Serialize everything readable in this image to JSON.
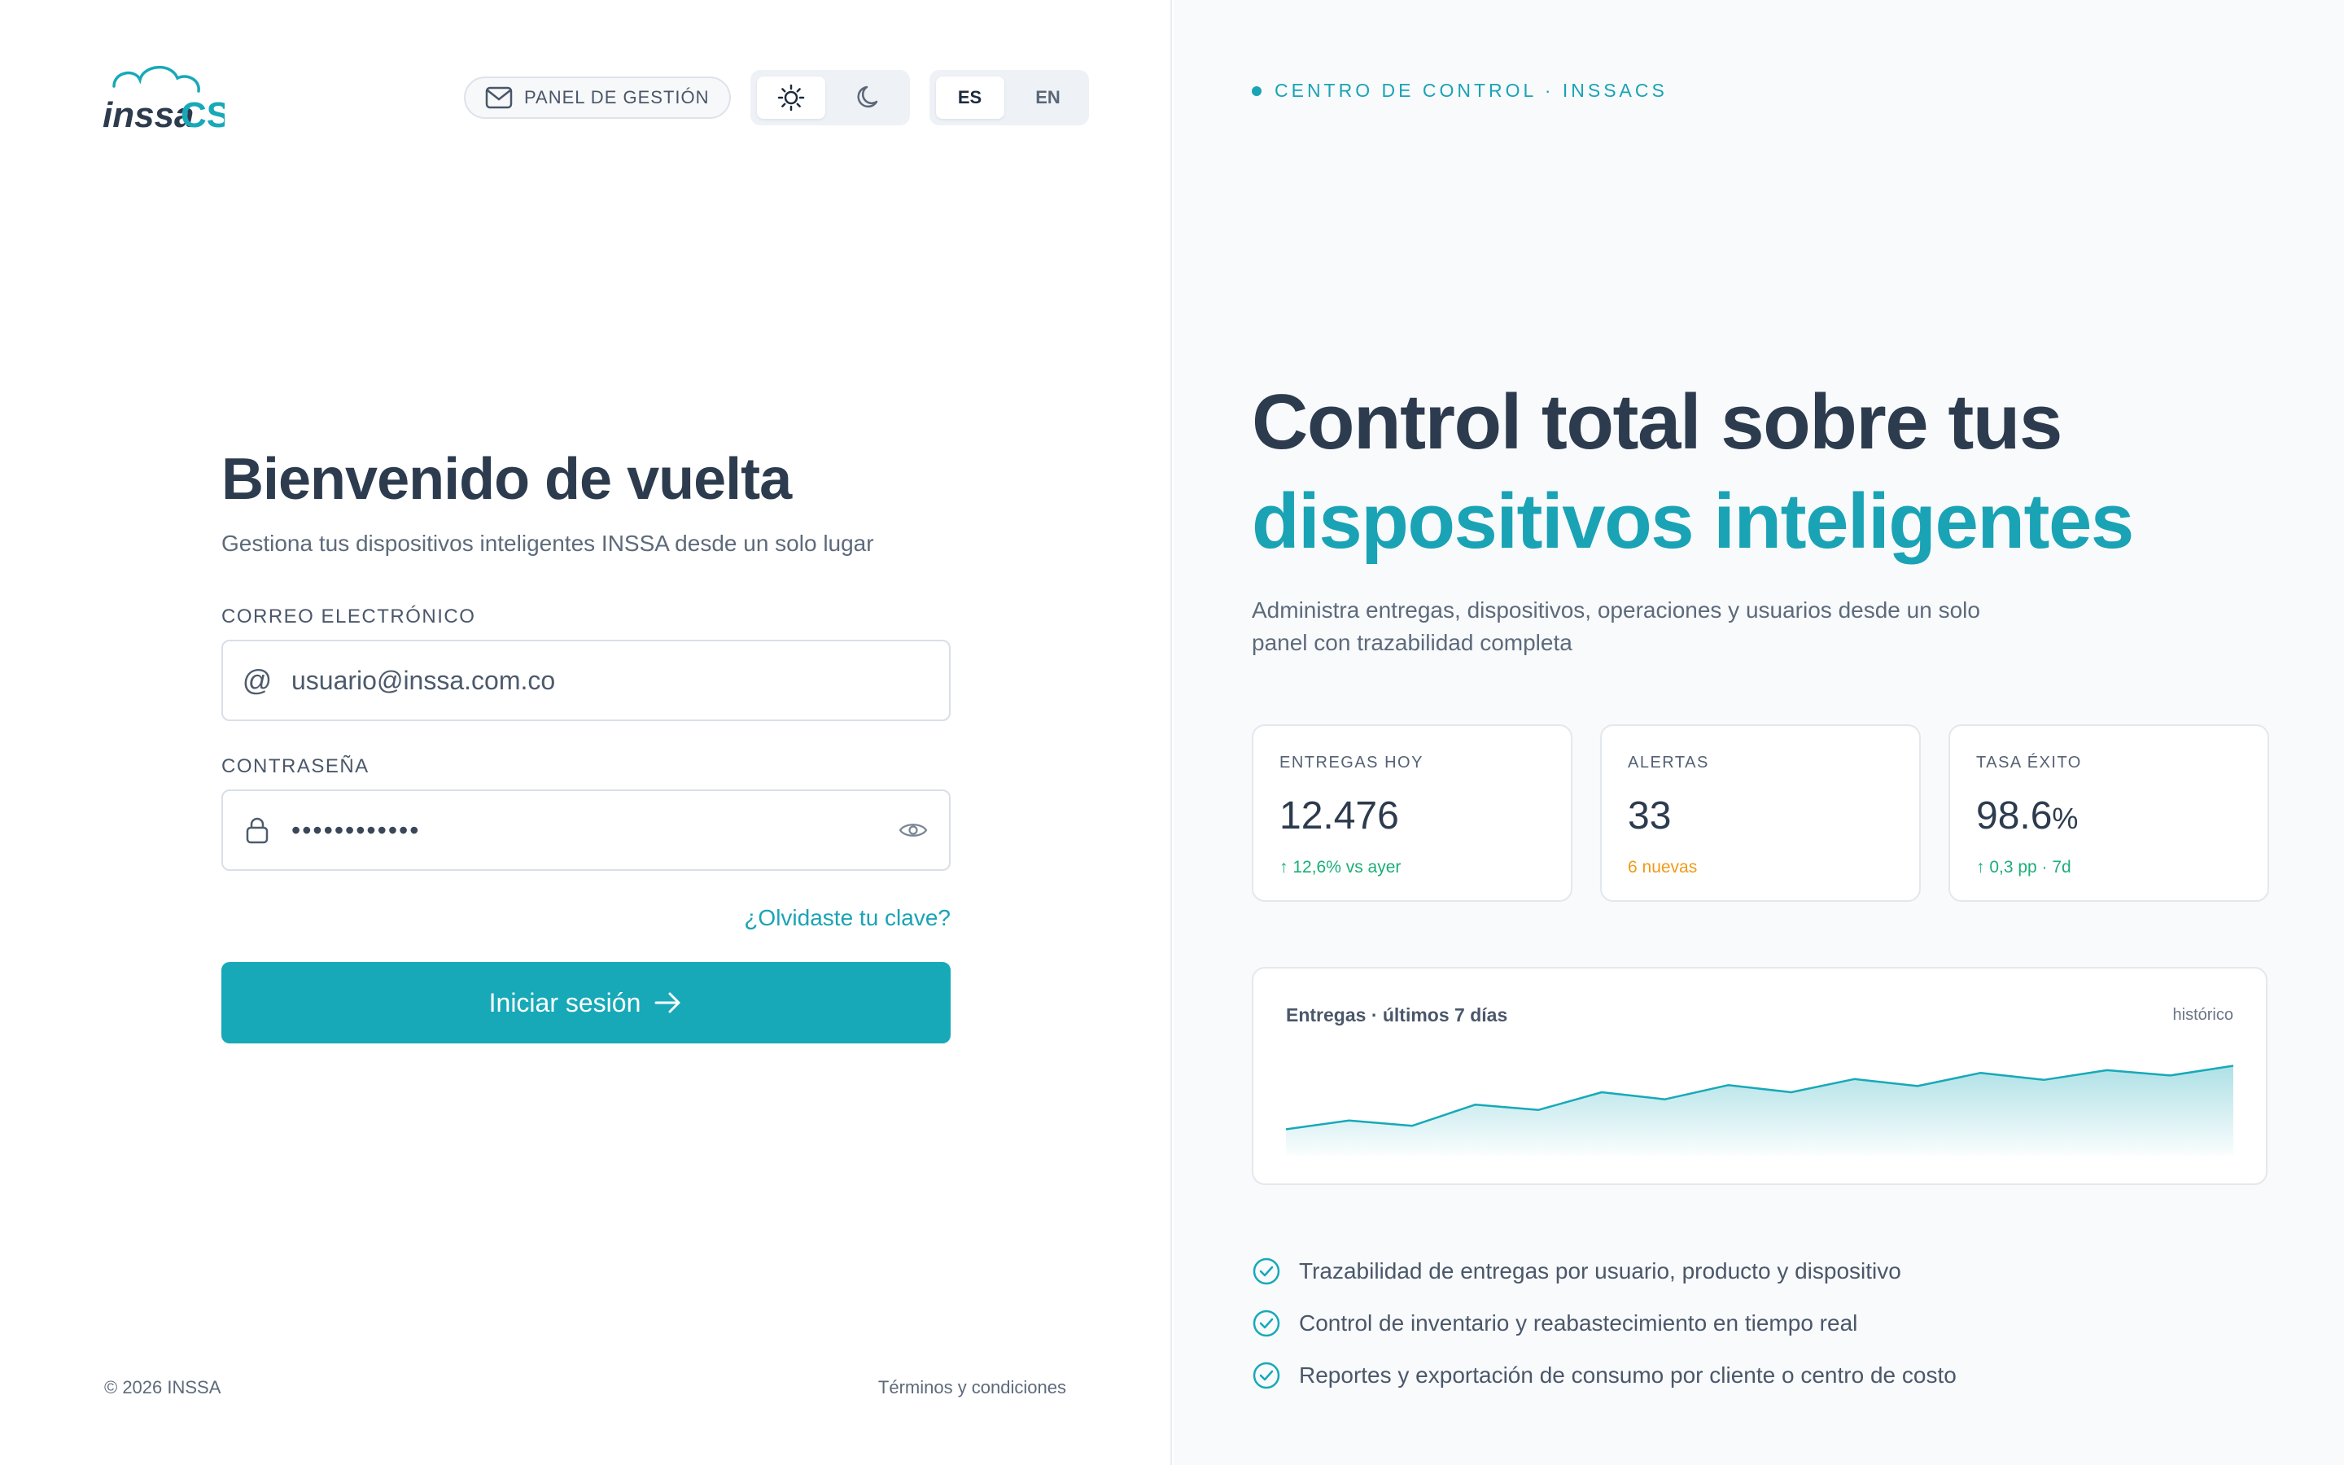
{
  "brand": {
    "logo_text_left": "inssa",
    "logo_text_right": "CS",
    "color_primary": "#17a9b8",
    "color_dark": "#2d3b4e"
  },
  "topbar": {
    "panel_button": {
      "label": "PANEL DE GESTIÓN",
      "icon": "mail-icon"
    },
    "theme": {
      "light_icon": "sun-icon",
      "dark_icon": "moon-icon",
      "active": "light"
    },
    "language": {
      "options": [
        "ES",
        "EN"
      ],
      "active": "ES"
    }
  },
  "login": {
    "title": "Bienvenido de vuelta",
    "subtitle": "Gestiona tus dispositivos inteligentes INSSA desde un solo lugar",
    "email_label": "CORREO ELECTRÓNICO",
    "email_placeholder": "usuario@inssa.com.co",
    "password_label": "CONTRASEÑA",
    "password_mask": "••••••••••••",
    "forgot": "¿Olvidaste tu clave?",
    "submit": "Iniciar sesión"
  },
  "footer": {
    "copyright": "© 2026 INSSA",
    "terms": "Términos y condiciones"
  },
  "right": {
    "eyebrow": "CENTRO DE CONTROL · INSSACS",
    "hero_line1": "Control total sobre tus",
    "hero_line2": "dispositivos inteligentes",
    "description": "Administra entregas, dispositivos, operaciones y usuarios desde un solo panel con trazabilidad completa",
    "stats": [
      {
        "label": "ENTREGAS HOY",
        "value": "12.476",
        "value_suffix": "",
        "delta": "↑ 12,6% vs ayer",
        "delta_color": "#1bae78"
      },
      {
        "label": "ALERTAS",
        "value": "33",
        "value_suffix": "",
        "delta": "6 nuevas",
        "delta_color": "#f09a17"
      },
      {
        "label": "TASA ÉXITO",
        "value": "98.6",
        "value_suffix": "%",
        "delta": "↑ 0,3 pp · 7d",
        "delta_color": "#1bae78"
      }
    ],
    "chart_title": "Entregas · últimos 7 días",
    "chart_tag": "histórico",
    "features": [
      "Trazabilidad de entregas por usuario, producto y dispositivo",
      "Control de inventario y reabastecimiento en tiempo real",
      "Reportes y exportación de consumo por cliente o centro de costo"
    ]
  },
  "chart_data": {
    "type": "area",
    "title": "Entregas · últimos 7 días",
    "x": [
      0,
      1,
      2,
      3,
      4,
      5,
      6,
      7,
      8,
      9,
      10,
      11,
      12,
      13,
      14,
      15
    ],
    "values": [
      30,
      40,
      34,
      58,
      52,
      72,
      64,
      80,
      72,
      87,
      79,
      94,
      86,
      97,
      91,
      102
    ],
    "ylim": [
      0,
      120
    ],
    "grid": false,
    "legend": "none",
    "color": "#17a9b8"
  }
}
